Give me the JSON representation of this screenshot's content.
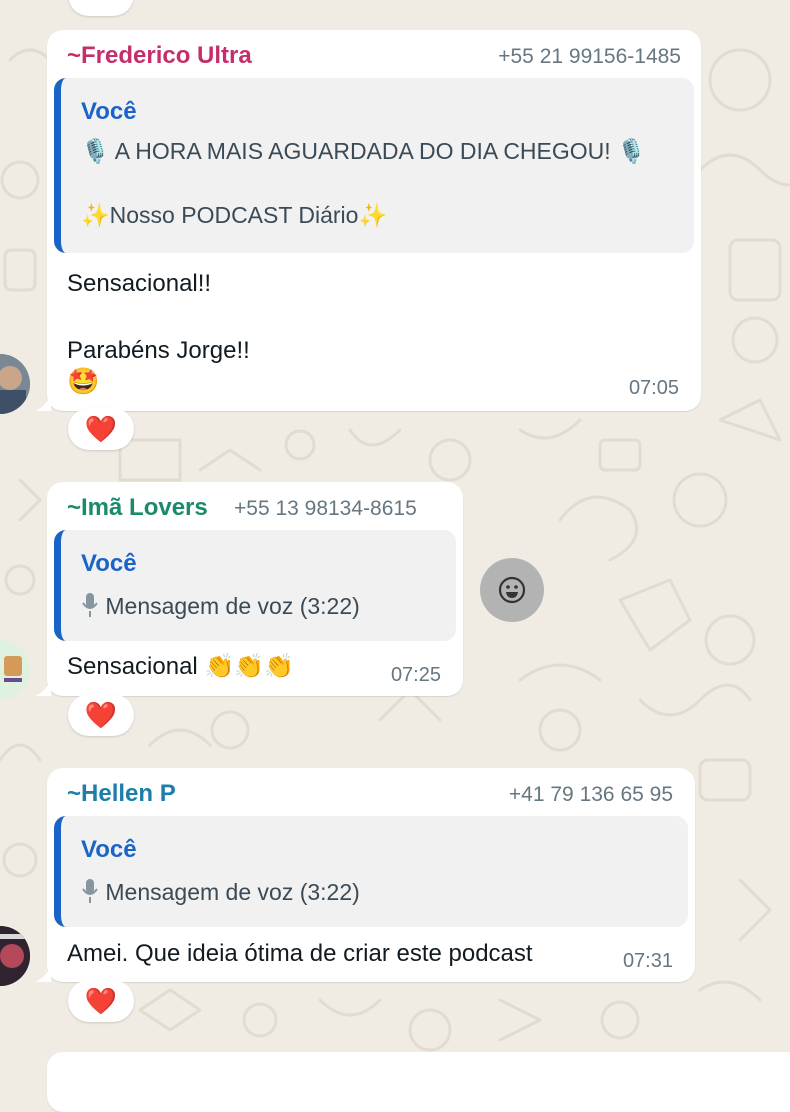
{
  "messages": [
    {
      "sender": "~Frederico Ultra",
      "sender_color": "#c42f6b",
      "phone": "+55 21 99156-1485",
      "quote": {
        "author": "Você",
        "line1": "A HORA MAIS AGUARDADA DO DIA CHEGOU!",
        "line2": "Nosso PODCAST Diário"
      },
      "body_line1": "Sensacional!!",
      "body_line2": "Parabéns Jorge!!",
      "time": "07:05",
      "reaction": "heart"
    },
    {
      "sender": "~Imã Lovers",
      "sender_color": "#1b8a6b",
      "phone": "+55 13 98134-8615",
      "quote": {
        "author": "Você",
        "line1": "Mensagem de voz (3:22)"
      },
      "body_line1": "Sensacional",
      "time": "07:25",
      "reaction": "heart"
    },
    {
      "sender": "~Hellen P",
      "sender_color": "#1d7fa8",
      "phone": "+41 79 136 65 95",
      "quote": {
        "author": "Você",
        "line1": "Mensagem de voz (3:22)"
      },
      "body_line1": "Amei. Que ideia ótima de criar este podcast",
      "time": "07:31",
      "reaction": "heart"
    }
  ]
}
